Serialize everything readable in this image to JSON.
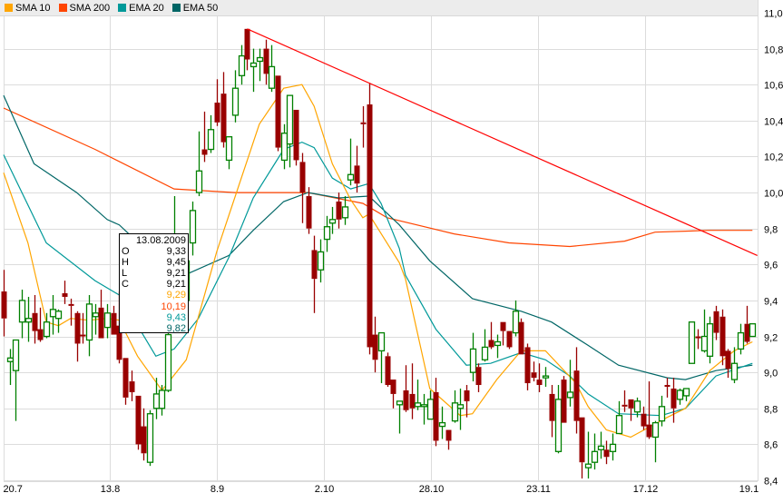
{
  "legend": [
    {
      "label": "SMA 10",
      "color": "#ffa500"
    },
    {
      "label": "SMA 200",
      "color": "#ff4500"
    },
    {
      "label": "EMA 20",
      "color": "#009999"
    },
    {
      "label": "EMA 50",
      "color": "#006666"
    }
  ],
  "tooltip": {
    "date": "13.08.2009",
    "rows": [
      {
        "key": "O",
        "value": "9,33"
      },
      {
        "key": "H",
        "value": "9,45"
      },
      {
        "key": "L",
        "value": "9,21"
      },
      {
        "key": "C",
        "value": "9,21"
      }
    ],
    "indicators": [
      {
        "value": "9,29",
        "color": "#ffa500"
      },
      {
        "value": "10,19",
        "color": "#ff4500"
      },
      {
        "value": "9,43",
        "color": "#009999"
      },
      {
        "value": "9,82",
        "color": "#006666"
      }
    ]
  },
  "chart_data": {
    "type": "candlestick",
    "ylim": [
      8.4,
      11.0
    ],
    "yticks": [
      {
        "v": 11.0,
        "label": "11,0"
      },
      {
        "v": 10.8,
        "label": "10,8"
      },
      {
        "v": 10.6,
        "label": "10,6"
      },
      {
        "v": 10.4,
        "label": "10,4"
      },
      {
        "v": 10.2,
        "label": "10,2"
      },
      {
        "v": 10.0,
        "label": "10,0"
      },
      {
        "v": 9.8,
        "label": "9,8"
      },
      {
        "v": 9.6,
        "label": "9,6"
      },
      {
        "v": 9.4,
        "label": "9,4"
      },
      {
        "v": 9.2,
        "label": "9,2"
      },
      {
        "v": 9.0,
        "label": "9,0"
      },
      {
        "v": 8.8,
        "label": "8,8"
      },
      {
        "v": 8.6,
        "label": "8,6"
      },
      {
        "v": 8.4,
        "label": "8,4"
      }
    ],
    "xticks": [
      {
        "i": 0,
        "label": "20.7",
        "grid": true
      },
      {
        "i": 17.4,
        "label": "13.8",
        "grid": true
      },
      {
        "i": 35,
        "label": "8.9",
        "grid": true
      },
      {
        "i": 52.6,
        "label": "2.10",
        "grid": true
      },
      {
        "i": 70.2,
        "label": "28.10",
        "grid": true
      },
      {
        "i": 87.8,
        "label": "23.11",
        "grid": true
      },
      {
        "i": 105.4,
        "label": "17.12",
        "grid": true
      },
      {
        "i": 122.4,
        "label": "19.1",
        "grid": false
      }
    ],
    "up_color": "#008000",
    "down_color": "#990000",
    "candles": [
      [
        9.45,
        9.57,
        9.2,
        9.3
      ],
      [
        9.06,
        9.13,
        8.93,
        9.08
      ],
      [
        9.01,
        9.18,
        8.73,
        9.18
      ],
      [
        9.28,
        9.46,
        9.19,
        9.4
      ],
      [
        9.28,
        9.42,
        9.17,
        9.3
      ],
      [
        9.33,
        9.43,
        9.16,
        9.23
      ],
      [
        9.24,
        9.36,
        9.17,
        9.18
      ],
      [
        9.2,
        9.33,
        9.19,
        9.28
      ],
      [
        9.31,
        9.43,
        9.21,
        9.35
      ],
      [
        9.3,
        9.35,
        9.22,
        9.34
      ],
      [
        9.44,
        9.51,
        9.38,
        9.42
      ],
      [
        9.38,
        9.41,
        9.26,
        9.37
      ],
      [
        9.33,
        9.34,
        9.06,
        9.16
      ],
      [
        9.21,
        9.33,
        9.16,
        9.2
      ],
      [
        9.18,
        9.43,
        9.09,
        9.38
      ],
      [
        9.31,
        9.38,
        9.21,
        9.33
      ],
      [
        9.36,
        9.46,
        9.19,
        9.19
      ],
      [
        9.25,
        9.38,
        9.19,
        9.33
      ],
      [
        9.33,
        9.37,
        9.21,
        9.21
      ],
      [
        9.26,
        9.45,
        9.05,
        9.07
      ],
      [
        9.08,
        9.08,
        8.82,
        8.86
      ],
      [
        8.95,
        9.01,
        8.84,
        8.89
      ],
      [
        8.87,
        8.87,
        8.57,
        8.6
      ],
      [
        8.7,
        8.8,
        8.51,
        8.55
      ],
      [
        8.5,
        8.79,
        8.48,
        8.77
      ],
      [
        8.8,
        8.97,
        8.74,
        8.88
      ],
      [
        8.8,
        8.93,
        8.76,
        8.9
      ],
      [
        8.9,
        9.25,
        8.89,
        9.21
      ],
      [
        9.25,
        9.98,
        9.22,
        9.3
      ],
      [
        9.45,
        9.52,
        9.38,
        9.4
      ],
      [
        9.4,
        9.64,
        9.38,
        9.62
      ],
      [
        9.72,
        9.95,
        9.65,
        9.9
      ],
      [
        10.0,
        10.34,
        9.98,
        10.12
      ],
      [
        10.24,
        10.45,
        10.17,
        10.21
      ],
      [
        10.24,
        10.43,
        10.22,
        10.35
      ],
      [
        10.5,
        10.63,
        10.37,
        10.39
      ],
      [
        10.55,
        10.67,
        10.25,
        10.28
      ],
      [
        10.18,
        10.31,
        10.13,
        10.31
      ],
      [
        10.43,
        10.68,
        10.39,
        10.58
      ],
      [
        10.65,
        10.82,
        10.6,
        10.76
      ],
      [
        10.91,
        10.91,
        10.68,
        10.74
      ],
      [
        10.7,
        10.8,
        10.56,
        10.72
      ],
      [
        10.73,
        10.8,
        10.62,
        10.75
      ],
      [
        10.8,
        10.85,
        10.6,
        10.66
      ],
      [
        10.58,
        10.82,
        10.56,
        10.7
      ],
      [
        10.65,
        10.65,
        10.23,
        10.25
      ],
      [
        10.18,
        10.38,
        10.13,
        10.33
      ],
      [
        10.27,
        10.54,
        10.14,
        10.54
      ],
      [
        10.46,
        10.46,
        10.15,
        10.18
      ],
      [
        10.17,
        10.22,
        9.83,
        10.0
      ],
      [
        9.98,
        10.03,
        9.77,
        9.8
      ],
      [
        9.68,
        9.76,
        9.33,
        9.52
      ],
      [
        9.57,
        9.74,
        9.5,
        9.67
      ],
      [
        9.74,
        9.87,
        9.67,
        9.81
      ],
      [
        9.83,
        9.92,
        9.77,
        9.85
      ],
      [
        9.95,
        10.0,
        9.8,
        9.85
      ],
      [
        9.86,
        9.98,
        9.82,
        9.92
      ],
      [
        10.07,
        10.3,
        10.04,
        10.1
      ],
      [
        10.15,
        10.26,
        10.0,
        10.05
      ],
      [
        10.39,
        10.48,
        10.25,
        10.38
      ],
      [
        10.49,
        10.61,
        9.1,
        9.14
      ],
      [
        9.21,
        9.31,
        9.0,
        9.07
      ],
      [
        9.12,
        9.22,
        8.94,
        9.22
      ],
      [
        9.09,
        9.11,
        8.92,
        8.93
      ],
      [
        8.96,
        8.96,
        8.8,
        8.88
      ],
      [
        8.82,
        8.83,
        8.66,
        8.84
      ],
      [
        8.9,
        9.04,
        8.78,
        8.79
      ],
      [
        8.88,
        9.05,
        8.74,
        8.8
      ],
      [
        8.81,
        8.96,
        8.79,
        8.83
      ],
      [
        8.82,
        8.88,
        8.71,
        8.82
      ],
      [
        8.74,
        8.9,
        8.74,
        8.85
      ],
      [
        8.89,
        8.97,
        8.59,
        8.62
      ],
      [
        8.7,
        8.81,
        8.63,
        8.72
      ],
      [
        8.68,
        8.68,
        8.57,
        8.62
      ],
      [
        8.73,
        8.9,
        8.72,
        8.83
      ],
      [
        8.8,
        8.91,
        8.68,
        8.82
      ],
      [
        8.9,
        8.93,
        8.75,
        8.84
      ],
      [
        9.0,
        9.22,
        8.95,
        9.13
      ],
      [
        9.03,
        9.05,
        8.89,
        8.93
      ],
      [
        9.07,
        9.24,
        9.06,
        9.14
      ],
      [
        9.18,
        9.28,
        9.13,
        9.14
      ],
      [
        9.15,
        9.21,
        9.08,
        9.17
      ],
      [
        9.28,
        9.28,
        9.15,
        9.23
      ],
      [
        9.23,
        9.23,
        9.13,
        9.14
      ],
      [
        9.22,
        9.4,
        9.2,
        9.34
      ],
      [
        9.28,
        9.3,
        9.1,
        9.1
      ],
      [
        9.14,
        9.16,
        8.9,
        8.94
      ],
      [
        9.0,
        9.06,
        8.95,
        8.97
      ],
      [
        8.96,
        9.05,
        8.89,
        8.93
      ],
      [
        8.97,
        9.03,
        8.92,
        8.98
      ],
      [
        8.88,
        8.93,
        8.64,
        8.73
      ],
      [
        8.56,
        8.93,
        8.55,
        8.85
      ],
      [
        8.96,
        8.98,
        8.72,
        8.72
      ],
      [
        8.86,
        9.07,
        8.81,
        8.89
      ],
      [
        9.01,
        9.14,
        8.66,
        8.73
      ],
      [
        8.75,
        8.75,
        8.41,
        8.5
      ],
      [
        8.47,
        8.67,
        8.41,
        8.49
      ],
      [
        8.5,
        8.66,
        8.46,
        8.56
      ],
      [
        8.57,
        8.67,
        8.52,
        8.59
      ],
      [
        8.57,
        8.62,
        8.49,
        8.53
      ],
      [
        8.56,
        8.66,
        8.51,
        8.6
      ],
      [
        8.66,
        8.84,
        8.66,
        8.76
      ],
      [
        8.82,
        8.9,
        8.78,
        8.81
      ],
      [
        8.85,
        8.85,
        8.73,
        8.8
      ],
      [
        8.78,
        8.86,
        8.75,
        8.84
      ],
      [
        8.77,
        8.81,
        8.68,
        8.7
      ],
      [
        8.71,
        8.95,
        8.63,
        8.64
      ],
      [
        8.64,
        8.73,
        8.5,
        8.72
      ],
      [
        8.73,
        8.87,
        8.7,
        8.81
      ],
      [
        8.93,
        8.97,
        8.86,
        8.92
      ],
      [
        8.91,
        8.97,
        8.72,
        8.8
      ],
      [
        8.85,
        8.91,
        8.82,
        8.9
      ],
      [
        8.87,
        8.91,
        8.84,
        8.91
      ],
      [
        9.05,
        9.28,
        9.05,
        9.28
      ],
      [
        9.2,
        9.24,
        9.13,
        9.19
      ],
      [
        9.12,
        9.35,
        9.11,
        9.2
      ],
      [
        9.09,
        9.31,
        9.05,
        9.27
      ],
      [
        9.34,
        9.37,
        9.18,
        9.22
      ],
      [
        9.31,
        9.35,
        9.04,
        9.09
      ],
      [
        9.12,
        9.13,
        8.97,
        9.02
      ],
      [
        8.96,
        9.14,
        8.94,
        9.05
      ],
      [
        9.13,
        9.27,
        9.1,
        9.22
      ],
      [
        9.27,
        9.37,
        9.16,
        9.17
      ],
      [
        9.2,
        9.27,
        9.2,
        9.27
      ]
    ],
    "indicators": [
      {
        "name": "SMA 200",
        "color": "#ff4500",
        "points": [
          [
            0,
            10.47
          ],
          [
            15,
            10.24
          ],
          [
            28,
            10.02
          ],
          [
            38,
            10.0
          ],
          [
            50,
            10.0
          ],
          [
            59,
            9.94
          ],
          [
            63,
            9.86
          ],
          [
            74,
            9.77
          ],
          [
            83,
            9.72
          ],
          [
            93,
            9.7
          ],
          [
            102,
            9.73
          ],
          [
            107,
            9.78
          ],
          [
            116,
            9.79
          ],
          [
            123,
            9.79
          ]
        ]
      },
      {
        "name": "EMA 50",
        "color": "#006666",
        "points": [
          [
            0,
            10.54
          ],
          [
            5,
            10.16
          ],
          [
            12,
            10.0
          ],
          [
            17,
            9.85
          ],
          [
            19,
            9.82
          ],
          [
            24,
            9.66
          ],
          [
            29,
            9.53
          ],
          [
            37,
            9.65
          ],
          [
            41,
            9.79
          ],
          [
            46,
            9.95
          ],
          [
            50,
            10.0
          ],
          [
            55,
            9.97
          ],
          [
            60,
            9.98
          ],
          [
            65,
            9.82
          ],
          [
            70,
            9.62
          ],
          [
            77,
            9.41
          ],
          [
            85,
            9.34
          ],
          [
            90,
            9.28
          ],
          [
            96,
            9.15
          ],
          [
            101,
            9.04
          ],
          [
            109,
            8.97
          ],
          [
            112,
            8.96
          ],
          [
            117,
            9.01
          ],
          [
            123,
            9.04
          ]
        ]
      },
      {
        "name": "EMA 20",
        "color": "#009999",
        "points": [
          [
            0,
            10.21
          ],
          [
            7,
            9.72
          ],
          [
            15,
            9.51
          ],
          [
            19,
            9.43
          ],
          [
            25,
            9.09
          ],
          [
            28,
            9.13
          ],
          [
            32,
            9.3
          ],
          [
            37,
            9.64
          ],
          [
            41,
            9.97
          ],
          [
            46,
            10.24
          ],
          [
            49,
            10.28
          ],
          [
            51,
            10.25
          ],
          [
            54,
            10.08
          ],
          [
            57,
            10.02
          ],
          [
            60,
            10.05
          ],
          [
            62,
            9.94
          ],
          [
            65,
            9.69
          ],
          [
            66,
            9.54
          ],
          [
            71,
            9.24
          ],
          [
            76,
            9.04
          ],
          [
            80,
            9.05
          ],
          [
            85,
            9.11
          ],
          [
            89,
            9.07
          ],
          [
            93,
            8.98
          ],
          [
            96,
            8.88
          ],
          [
            101,
            8.77
          ],
          [
            108,
            8.76
          ],
          [
            112,
            8.8
          ],
          [
            117,
            8.98
          ],
          [
            123,
            9.05
          ]
        ]
      },
      {
        "name": "SMA 10",
        "color": "#ffa500",
        "points": [
          [
            0,
            10.11
          ],
          [
            4,
            9.72
          ],
          [
            7,
            9.28
          ],
          [
            9,
            9.26
          ],
          [
            11,
            9.3
          ],
          [
            14,
            9.29
          ],
          [
            17,
            9.3
          ],
          [
            19,
            9.29
          ],
          [
            22,
            9.09
          ],
          [
            26,
            8.9
          ],
          [
            30,
            9.07
          ],
          [
            35,
            9.67
          ],
          [
            42,
            10.38
          ],
          [
            46,
            10.58
          ],
          [
            49,
            10.6
          ],
          [
            51,
            10.48
          ],
          [
            54,
            10.16
          ],
          [
            57,
            9.96
          ],
          [
            59,
            9.86
          ],
          [
            60,
            9.88
          ],
          [
            65,
            9.61
          ],
          [
            66,
            9.52
          ],
          [
            70,
            8.91
          ],
          [
            75,
            8.76
          ],
          [
            77,
            8.77
          ],
          [
            81,
            8.96
          ],
          [
            85,
            9.12
          ],
          [
            89,
            9.12
          ],
          [
            94,
            8.94
          ],
          [
            96,
            8.81
          ],
          [
            99,
            8.68
          ],
          [
            103,
            8.64
          ],
          [
            109,
            8.75
          ],
          [
            112,
            8.8
          ],
          [
            116,
            9.01
          ],
          [
            120,
            9.12
          ],
          [
            123,
            9.17
          ]
        ]
      }
    ],
    "trendline": {
      "color": "#ff0000",
      "points": [
        [
          40,
          10.91
        ],
        [
          123.8,
          9.65
        ]
      ]
    }
  }
}
